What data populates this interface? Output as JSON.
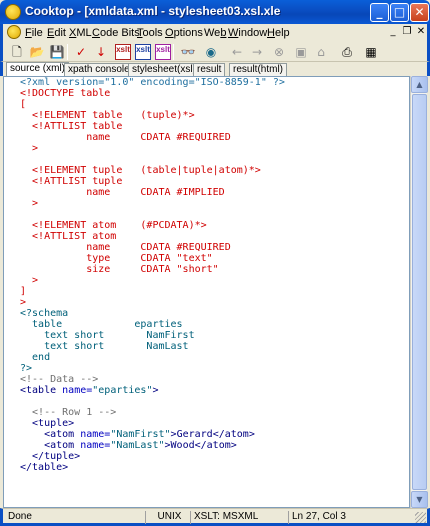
{
  "window": {
    "title": "Cooktop - [xmldata.xml - stylesheet03.xsl.xle",
    "minimize": "_",
    "maximize": "□",
    "close": "✕"
  },
  "menu": {
    "items": [
      "File",
      "Edit",
      "XML",
      "Code Bits",
      "Tools",
      "Options",
      "Web",
      "Window",
      "Help"
    ],
    "underline": [
      "F",
      "E",
      "X",
      "C",
      "T",
      "O",
      "b",
      "W",
      "H"
    ]
  },
  "toolbar": {
    "xslt_labels": [
      "xslt",
      "xslt",
      "xslt"
    ]
  },
  "tabs": [
    "source (xml)",
    "xpath console",
    "stylesheet(xsl)",
    "result",
    "result(html)"
  ],
  "code": [
    [
      [
        "c-decl",
        "<?xml version=\"1.0\" encoding=\"ISO-8859-1\" ?>"
      ]
    ],
    [
      [
        "c-red",
        "<!DOCTYPE table"
      ]
    ],
    [
      [
        "c-red",
        "["
      ]
    ],
    [
      [
        "c-red",
        "  <!ELEMENT table   (tuple)*>"
      ]
    ],
    [
      [
        "c-red",
        "  <!ATTLIST table"
      ]
    ],
    [
      [
        "c-red",
        "           name     CDATA #REQUIRED"
      ]
    ],
    [
      [
        "c-red",
        "  >"
      ]
    ],
    [
      [
        "",
        ""
      ]
    ],
    [
      [
        "c-red",
        "  <!ELEMENT tuple   (table|tuple|atom)*>"
      ]
    ],
    [
      [
        "c-red",
        "  <!ATTLIST tuple"
      ]
    ],
    [
      [
        "c-red",
        "           name     CDATA #IMPLIED"
      ]
    ],
    [
      [
        "c-red",
        "  >"
      ]
    ],
    [
      [
        "",
        ""
      ]
    ],
    [
      [
        "c-red",
        "  <!ELEMENT atom    (#PCDATA)*>"
      ]
    ],
    [
      [
        "c-red",
        "  <!ATTLIST atom"
      ]
    ],
    [
      [
        "c-red",
        "           name     CDATA #REQUIRED"
      ]
    ],
    [
      [
        "c-red",
        "           type     CDATA \"text\""
      ]
    ],
    [
      [
        "c-red",
        "           size     CDATA \"short\""
      ]
    ],
    [
      [
        "c-red",
        "  >"
      ]
    ],
    [
      [
        "c-red",
        "]"
      ]
    ],
    [
      [
        "c-red",
        ">"
      ]
    ],
    [
      [
        "c-green",
        "<?schema"
      ]
    ],
    [
      [
        "c-green",
        "  table            eparties"
      ]
    ],
    [
      [
        "c-green",
        "    text short       NamFirst"
      ]
    ],
    [
      [
        "c-green",
        "    text short       NamLast"
      ]
    ],
    [
      [
        "c-green",
        "  end"
      ]
    ],
    [
      [
        "c-green",
        "?>"
      ]
    ],
    [
      [
        "c-grey",
        "<!-- Data -->"
      ]
    ],
    [
      [
        "c-navy",
        "<table "
      ],
      [
        "c-blue",
        "name="
      ],
      [
        "c-green",
        "\"eparties\""
      ],
      [
        "c-navy",
        ">"
      ]
    ],
    [
      [
        "",
        ""
      ]
    ],
    [
      [
        "c-grey",
        "  <!-- Row 1 -->"
      ]
    ],
    [
      [
        "c-navy",
        "  <tuple>"
      ]
    ],
    [
      [
        "c-navy",
        "    <atom "
      ],
      [
        "c-blue",
        "name="
      ],
      [
        "c-green",
        "\"NamFirst\""
      ],
      [
        "c-navy",
        ">Gerard</atom>"
      ]
    ],
    [
      [
        "c-navy",
        "    <atom "
      ],
      [
        "c-blue",
        "name="
      ],
      [
        "c-green",
        "\"NamLast\""
      ],
      [
        "c-navy",
        ">Wood</atom>"
      ]
    ],
    [
      [
        "c-navy",
        "  </tuple>"
      ]
    ],
    [
      [
        "c-navy",
        "</table>"
      ]
    ]
  ],
  "status": {
    "mode": "Done",
    "line_endings": "UNIX",
    "xslt": "XSLT: MSXML",
    "position": "Ln 27, Col 3"
  }
}
